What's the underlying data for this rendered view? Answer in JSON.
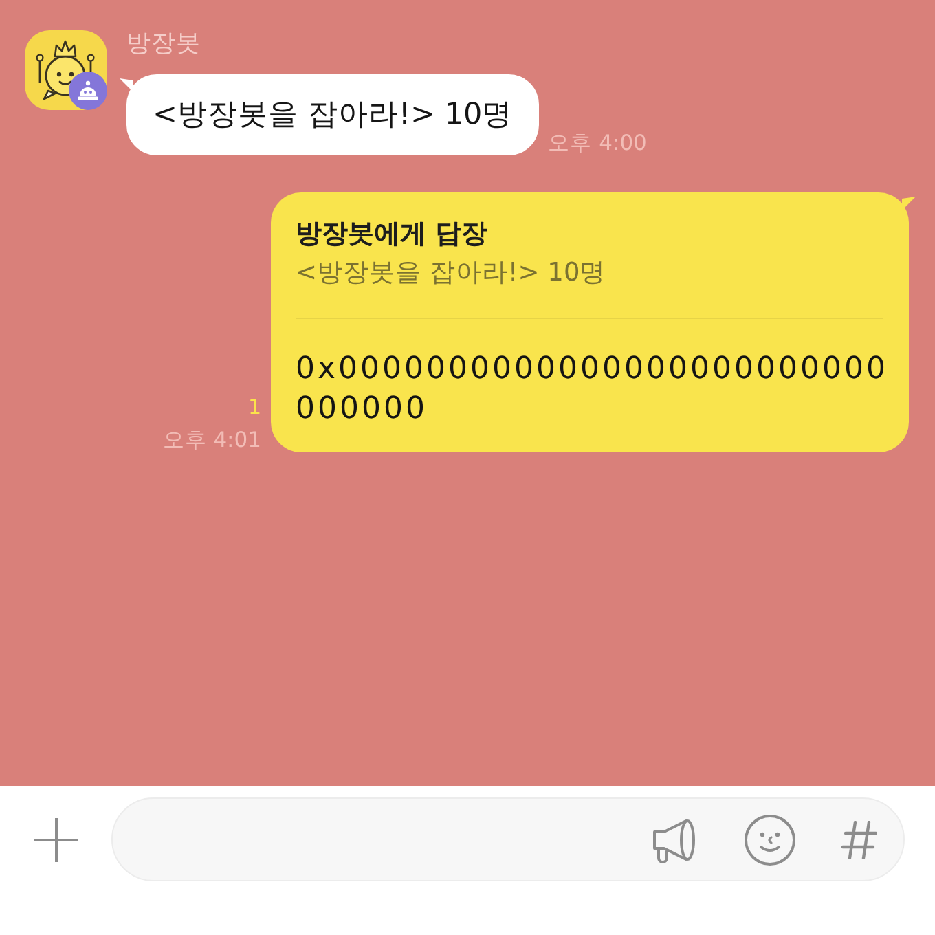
{
  "chat": {
    "messages": [
      {
        "kind": "incoming",
        "sender": "방장봇",
        "text": "<방장봇을 잡아라!> 10명",
        "time": "오후 4:00"
      },
      {
        "kind": "outgoing",
        "reply": {
          "header": "방장봇에게 답장",
          "quote": "<방장봇을 잡아라!> 10명"
        },
        "text": "0x0000000000000000000000000000000",
        "unread": "1",
        "time": "오후 4:01"
      }
    ]
  }
}
